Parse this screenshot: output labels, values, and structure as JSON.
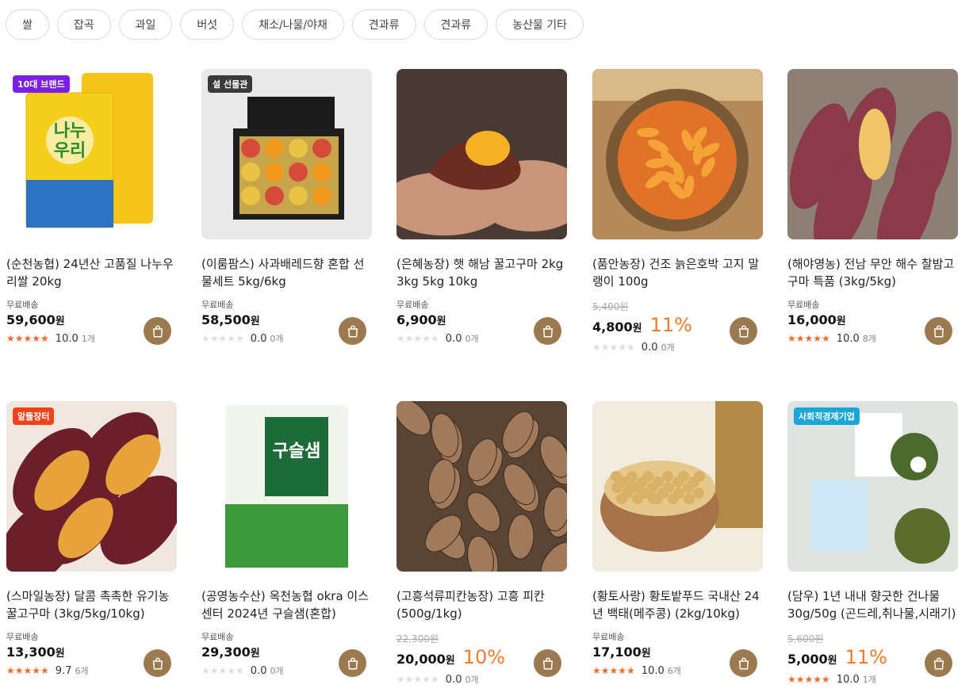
{
  "categories": [
    "쌀",
    "잡곡",
    "과일",
    "버섯",
    "채소/나물/야채",
    "견과류",
    "견과류",
    "농산물 기타"
  ],
  "products": [
    {
      "badge": "10대 브랜드",
      "badge_color": "#7a1ee8",
      "img": "rice-bag",
      "title": "(순천농협) 24년산 고품질 나누우리쌀 20kg",
      "ship": "무료배송",
      "orig": "",
      "price": "59,600",
      "won": "원",
      "disc": "",
      "stars_on": true,
      "score": "10.0",
      "count": "1개"
    },
    {
      "badge": "설 선물관",
      "badge_color": "#3a3a3a",
      "img": "gift-box",
      "title": "(이룸팜스) 사과배레드향 혼합 선물세트 5kg/6kg",
      "ship": "무료배송",
      "orig": "",
      "price": "58,500",
      "won": "원",
      "disc": "",
      "stars_on": false,
      "score": "0.0",
      "count": "0개"
    },
    {
      "badge": "",
      "badge_color": "",
      "img": "sweet-potato-hand",
      "title": "(은혜농장) 햇 해남 꿀고구마 2kg 3kg 5kg 10kg",
      "ship": "무료배송",
      "orig": "",
      "price": "6,900",
      "won": "원",
      "disc": "",
      "stars_on": false,
      "score": "0.0",
      "count": "0개"
    },
    {
      "badge": "",
      "badge_color": "",
      "img": "dried-pumpkin",
      "title": "(품안농장) 건조 늙은호박 고지 말랭이 100g",
      "ship": "",
      "orig": "5,400원",
      "price": "4,800",
      "won": "원",
      "disc": "11%",
      "stars_on": false,
      "score": "0.0",
      "count": "0개"
    },
    {
      "badge": "",
      "badge_color": "",
      "img": "sweet-potato-pile",
      "title": "(해야영농) 전남 무안 해수 찰밤고구마 특품 (3kg/5kg)",
      "ship": "무료배송",
      "orig": "",
      "price": "16,000",
      "won": "원",
      "disc": "",
      "stars_on": true,
      "score": "10.0",
      "count": "8개"
    },
    {
      "badge": "알뜰장터",
      "badge_color": "#f0431b",
      "img": "roasted-sweet-potato",
      "title": "(스마일농장) 달콤 촉촉한 유기농 꿀고구마 (3kg/5kg/10kg)",
      "ship": "무료배송",
      "orig": "",
      "price": "13,300",
      "won": "원",
      "disc": "",
      "stars_on": true,
      "score": "9.7",
      "count": "6개"
    },
    {
      "badge": "",
      "badge_color": "",
      "img": "green-rice-bag",
      "title": "(공영농수산) 옥천농협 okra 이스센터 2024년 구슬샘(혼합)",
      "ship": "무료배송",
      "orig": "",
      "price": "29,300",
      "won": "원",
      "disc": "",
      "stars_on": false,
      "score": "0.0",
      "count": "0개"
    },
    {
      "badge": "",
      "badge_color": "",
      "img": "pecans",
      "title": "(고흥석류피칸농장) 고흥 피칸 (500g/1kg)",
      "ship": "",
      "orig": "22,300원",
      "price": "20,000",
      "won": "원",
      "disc": "10%",
      "stars_on": false,
      "score": "0.0",
      "count": "0개"
    },
    {
      "badge": "",
      "badge_color": "",
      "img": "soybeans",
      "title": "(황토사랑) 황토밭푸드 국내산 24년 백태(메주콩) (2kg/10kg)",
      "ship": "무료배송",
      "orig": "",
      "price": "17,100",
      "won": "원",
      "disc": "",
      "stars_on": true,
      "score": "10.0",
      "count": "6개"
    },
    {
      "badge": "사회적경제기업",
      "badge_color": "#1aa6d6",
      "img": "dried-greens",
      "title": "(담우) 1년 내내 향긋한 건나물 30g/50g (곤드레,취나물,시래기)",
      "ship": "",
      "orig": "5,600원",
      "price": "5,000",
      "won": "원",
      "disc": "11%",
      "stars_on": true,
      "score": "10.0",
      "count": "1개"
    }
  ]
}
